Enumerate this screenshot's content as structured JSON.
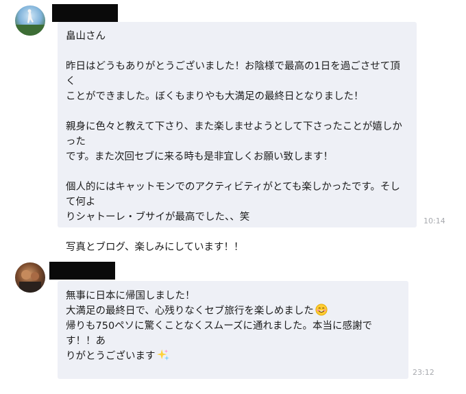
{
  "messages": [
    {
      "lines": [
        "畠山さん",
        "",
        "昨日はどうもありがとうございました！お陰様で最高の1日を過ごさせて頂く",
        "ことができました。ぼくもまりやも大満足の最終日となりました！",
        "",
        "親身に色々と教えて下さり、また楽しませようとして下さったことが嬉しかった",
        "です。また次回セブに来る時も是非宜しくお願い致します！",
        "",
        "個人的にはキャットモンでのアクティビティがとても楽しかったです。そして何よ",
        "りシャトーレ・ブサイが最高でした、、笑",
        "",
        "写真とブログ、楽しみにしています！！"
      ],
      "time": "10:14"
    },
    {
      "lines": [
        "無事に日本に帰国しました！",
        "大満足の最終日で、心残りなくセブ旅行を楽しめました",
        "帰りも750ペソに驚くことなくスムーズに通れました。本当に感謝です！！あ",
        "りがとうございます"
      ],
      "emoji": {
        "smile_icon": "smiling-face-icon",
        "sparkle_icon": "sparkles-icon"
      },
      "time": "23:12"
    }
  ]
}
